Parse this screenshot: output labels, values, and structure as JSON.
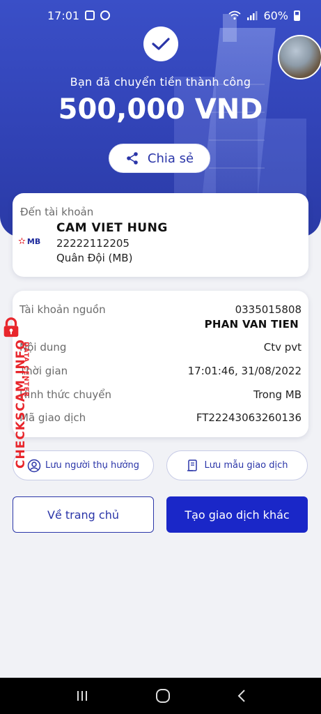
{
  "status_bar": {
    "time": "17:01",
    "battery": "60%"
  },
  "hero": {
    "label": "Bạn đã chuyển tiền thành công",
    "amount": "500,000 VND",
    "share_label": "Chia sẻ"
  },
  "recipient": {
    "label": "Đến tài khoản",
    "bank_logo": "MB",
    "name": "CAM VIET HUNG",
    "account": "22222112205",
    "bank": "Quân Đội (MB)"
  },
  "details": {
    "source_label": "Tài khoản nguồn",
    "source_account": "0335015808",
    "source_name": "PHAN VAN TIEN",
    "content_label": "Nội dung",
    "content_value": "Ctv pvt",
    "time_label": "Thời gian",
    "time_value": "17:01:46, 31/08/2022",
    "method_label": "Hình thức chuyển",
    "method_value": "Trong MB",
    "txn_label": "Mã giao dịch",
    "txn_value": "FT22243063260136"
  },
  "actions": {
    "save_beneficiary": "Lưu người thụ hưởng",
    "save_template": "Lưu mẫu giao dịch",
    "home": "Về trang chủ",
    "new_transaction": "Tạo giao dịch khác"
  },
  "watermark": {
    "main": "CHECKSCAM.INFO",
    "sub": "DATA CENTER"
  },
  "colors": {
    "primary": "#1a27c8",
    "hero": "#3244b8",
    "watermark": "#e8262c"
  }
}
